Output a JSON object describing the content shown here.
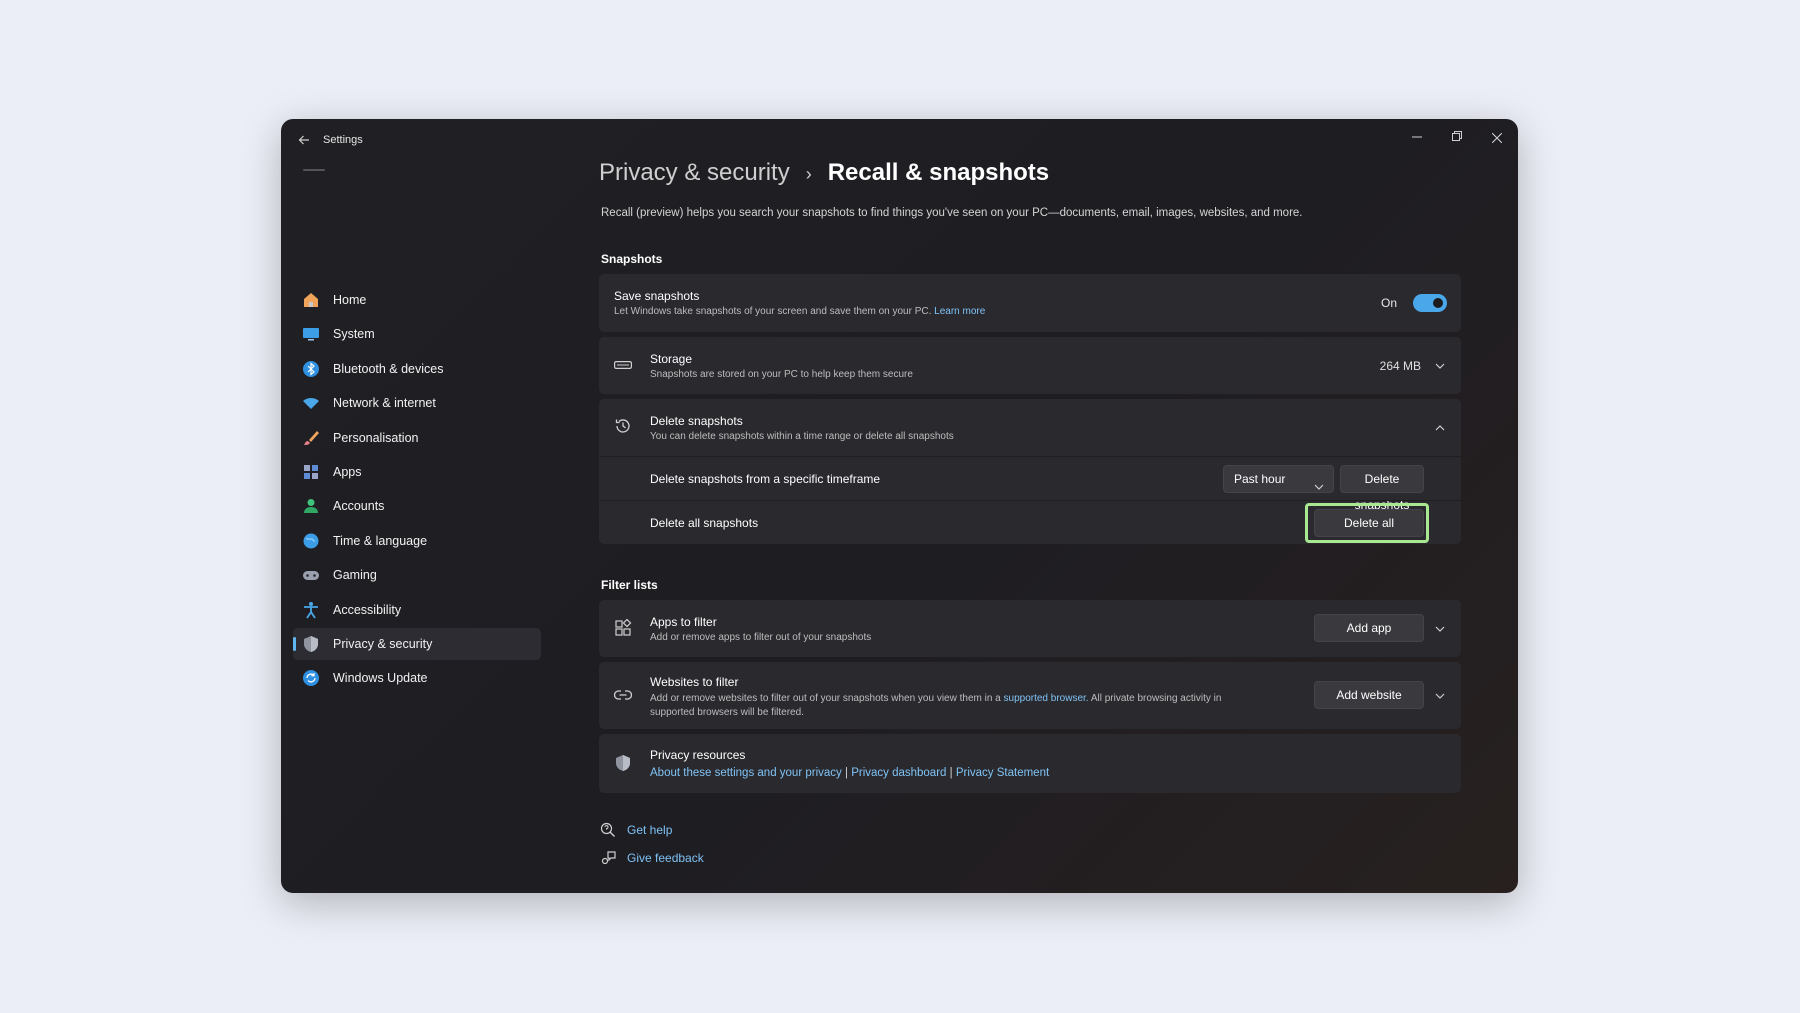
{
  "window": {
    "title": "Settings"
  },
  "sidebar": {
    "items": [
      {
        "label": "Home",
        "icon": "home-icon"
      },
      {
        "label": "System",
        "icon": "system-icon"
      },
      {
        "label": "Bluetooth & devices",
        "icon": "bluetooth-icon"
      },
      {
        "label": "Network & internet",
        "icon": "wifi-icon"
      },
      {
        "label": "Personalisation",
        "icon": "brush-icon"
      },
      {
        "label": "Apps",
        "icon": "apps-icon"
      },
      {
        "label": "Accounts",
        "icon": "accounts-icon"
      },
      {
        "label": "Time & language",
        "icon": "globe-icon"
      },
      {
        "label": "Gaming",
        "icon": "gamepad-icon"
      },
      {
        "label": "Accessibility",
        "icon": "accessibility-icon"
      },
      {
        "label": "Privacy & security",
        "icon": "shield-icon",
        "active": true
      },
      {
        "label": "Windows Update",
        "icon": "update-icon"
      }
    ]
  },
  "header": {
    "parent": "Privacy & security",
    "separator": "›",
    "current": "Recall & snapshots",
    "description": "Recall (preview) helps you search your snapshots to find things you've seen on your PC—documents, email, images, websites, and more."
  },
  "snapshots": {
    "section_title": "Snapshots",
    "save": {
      "title": "Save snapshots",
      "subtitle": "Let Windows take snapshots of your screen and save them on your PC.",
      "link": "Learn more",
      "state_label": "On",
      "toggle_on": true
    },
    "storage": {
      "title": "Storage",
      "subtitle": "Snapshots are stored on your PC to help keep them secure",
      "value": "264 MB"
    },
    "delete": {
      "title": "Delete snapshots",
      "subtitle": "You can delete snapshots within a time range or delete all snapshots",
      "timeframe_label": "Delete snapshots from a specific timeframe",
      "timeframe_value": "Past hour",
      "timeframe_button": "Delete snapshots",
      "all_label": "Delete all snapshots",
      "all_button": "Delete all"
    }
  },
  "filters": {
    "section_title": "Filter lists",
    "apps": {
      "title": "Apps to filter",
      "subtitle": "Add or remove apps to filter out of your snapshots",
      "button": "Add app"
    },
    "websites": {
      "title": "Websites to filter",
      "subtitle_pre": "Add or remove websites to filter out of your snapshots when you view them in a",
      "subtitle_link": "supported browser.",
      "subtitle_post": "All private browsing activity in supported browsers will be filtered.",
      "button": "Add website"
    },
    "privacy": {
      "title": "Privacy resources",
      "link1": "About these settings and your privacy",
      "link2": "Privacy dashboard",
      "link3": "Privacy Statement",
      "divider": "|"
    }
  },
  "footer": {
    "help": "Get help",
    "feedback": "Give feedback"
  },
  "colors": {
    "accent": "#4aa8ea",
    "highlight": "#a8e890",
    "link": "#7fc3f5"
  }
}
